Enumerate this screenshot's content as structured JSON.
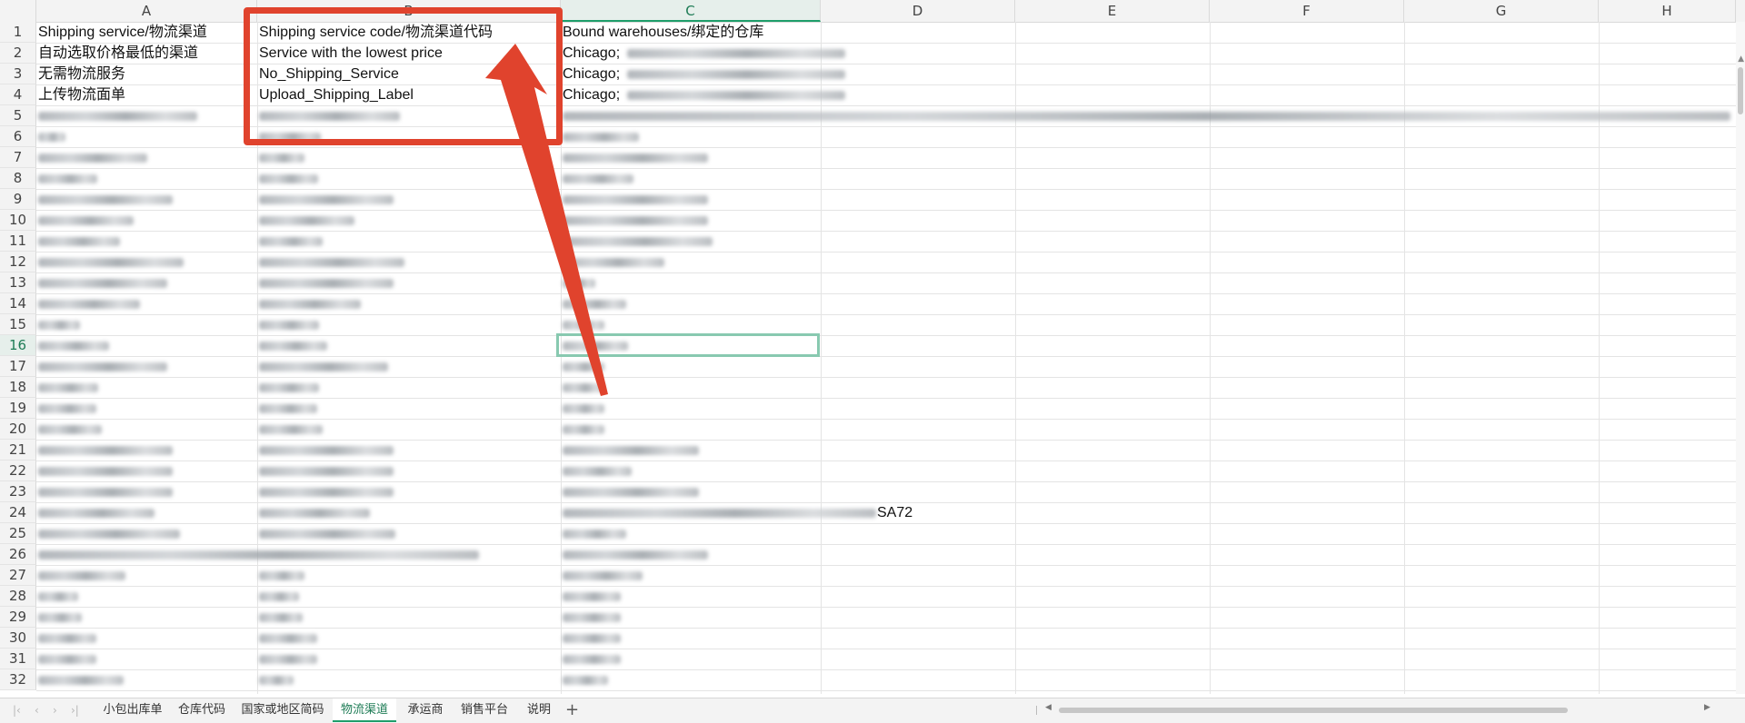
{
  "sheet": {
    "columns": [
      "A",
      "B",
      "C",
      "D",
      "E",
      "F",
      "G",
      "H"
    ],
    "active_column": "C",
    "rows": [
      "1",
      "2",
      "3",
      "4",
      "5",
      "6",
      "7",
      "8",
      "9",
      "10",
      "11",
      "12",
      "13",
      "14",
      "15",
      "16",
      "17",
      "18",
      "19",
      "20",
      "21",
      "22",
      "23",
      "24",
      "25",
      "26",
      "27",
      "28",
      "29",
      "30",
      "31",
      "32"
    ],
    "active_row": "16",
    "cells": {
      "a1": "Shipping service/物流渠道",
      "b1": "Shipping service code/物流渠道代码",
      "c1": "Bound warehouses/绑定的仓库",
      "a2": "自动选取价格最低的渠道",
      "b2": "Service with the lowest price",
      "c2": "Chicago;",
      "a3": "无需物流服务",
      "b3": "No_Shipping_Service",
      "c3": "Chicago;",
      "a4": "上传物流面单",
      "b4": "Upload_Shipping_Label",
      "c4": "Chicago;",
      "c24_tail": "SA72"
    }
  },
  "tabs": {
    "items": [
      "小包出库单",
      "仓库代码",
      "国家或地区简码",
      "物流渠道",
      "承运商",
      "销售平台",
      "说明"
    ],
    "active": "物流渠道",
    "add_label": "+"
  },
  "colors": {
    "annotation_red": "#e0432d",
    "active_green": "#1e9e6a"
  }
}
